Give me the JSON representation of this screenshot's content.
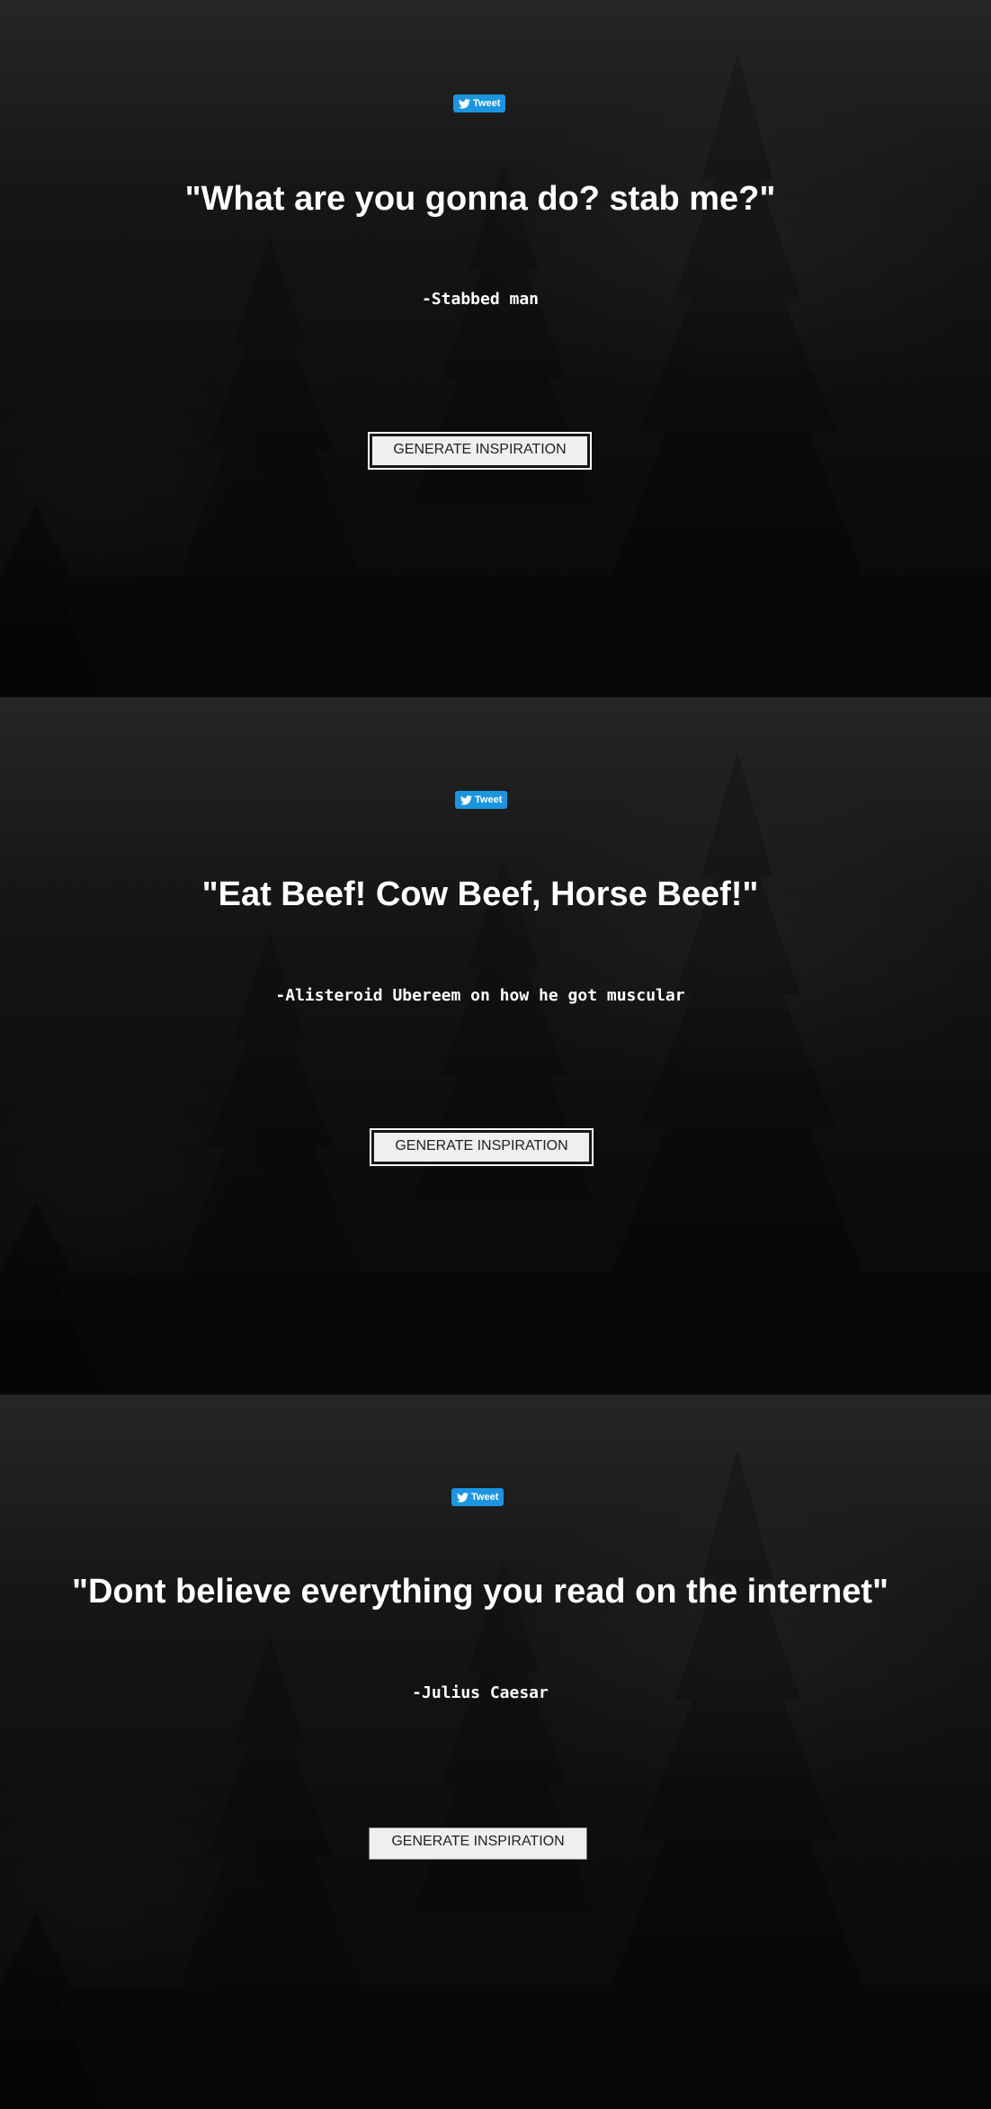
{
  "panels": [
    {
      "tweet_label": "Tweet",
      "quote": "\"What are you gonna do? stab me?\"",
      "author": "-Stabbed man",
      "button_label": "GENERATE INSPIRATION"
    },
    {
      "tweet_label": "Tweet",
      "quote": "\"Eat Beef! Cow Beef, Horse Beef!\"",
      "author": "-Alisteroid Ubereem on how he got muscular",
      "button_label": "GENERATE INSPIRATION"
    },
    {
      "tweet_label": "Tweet",
      "quote": "\"Dont believe everything you read on the internet\"",
      "author": "-Julius Caesar",
      "button_label": "GENERATE INSPIRATION"
    }
  ],
  "colors": {
    "tweet_blue": "#1b95e0",
    "text": "#ffffff",
    "button_bg": "#efefef"
  },
  "icons": {
    "tweet": "twitter-bird-icon"
  }
}
